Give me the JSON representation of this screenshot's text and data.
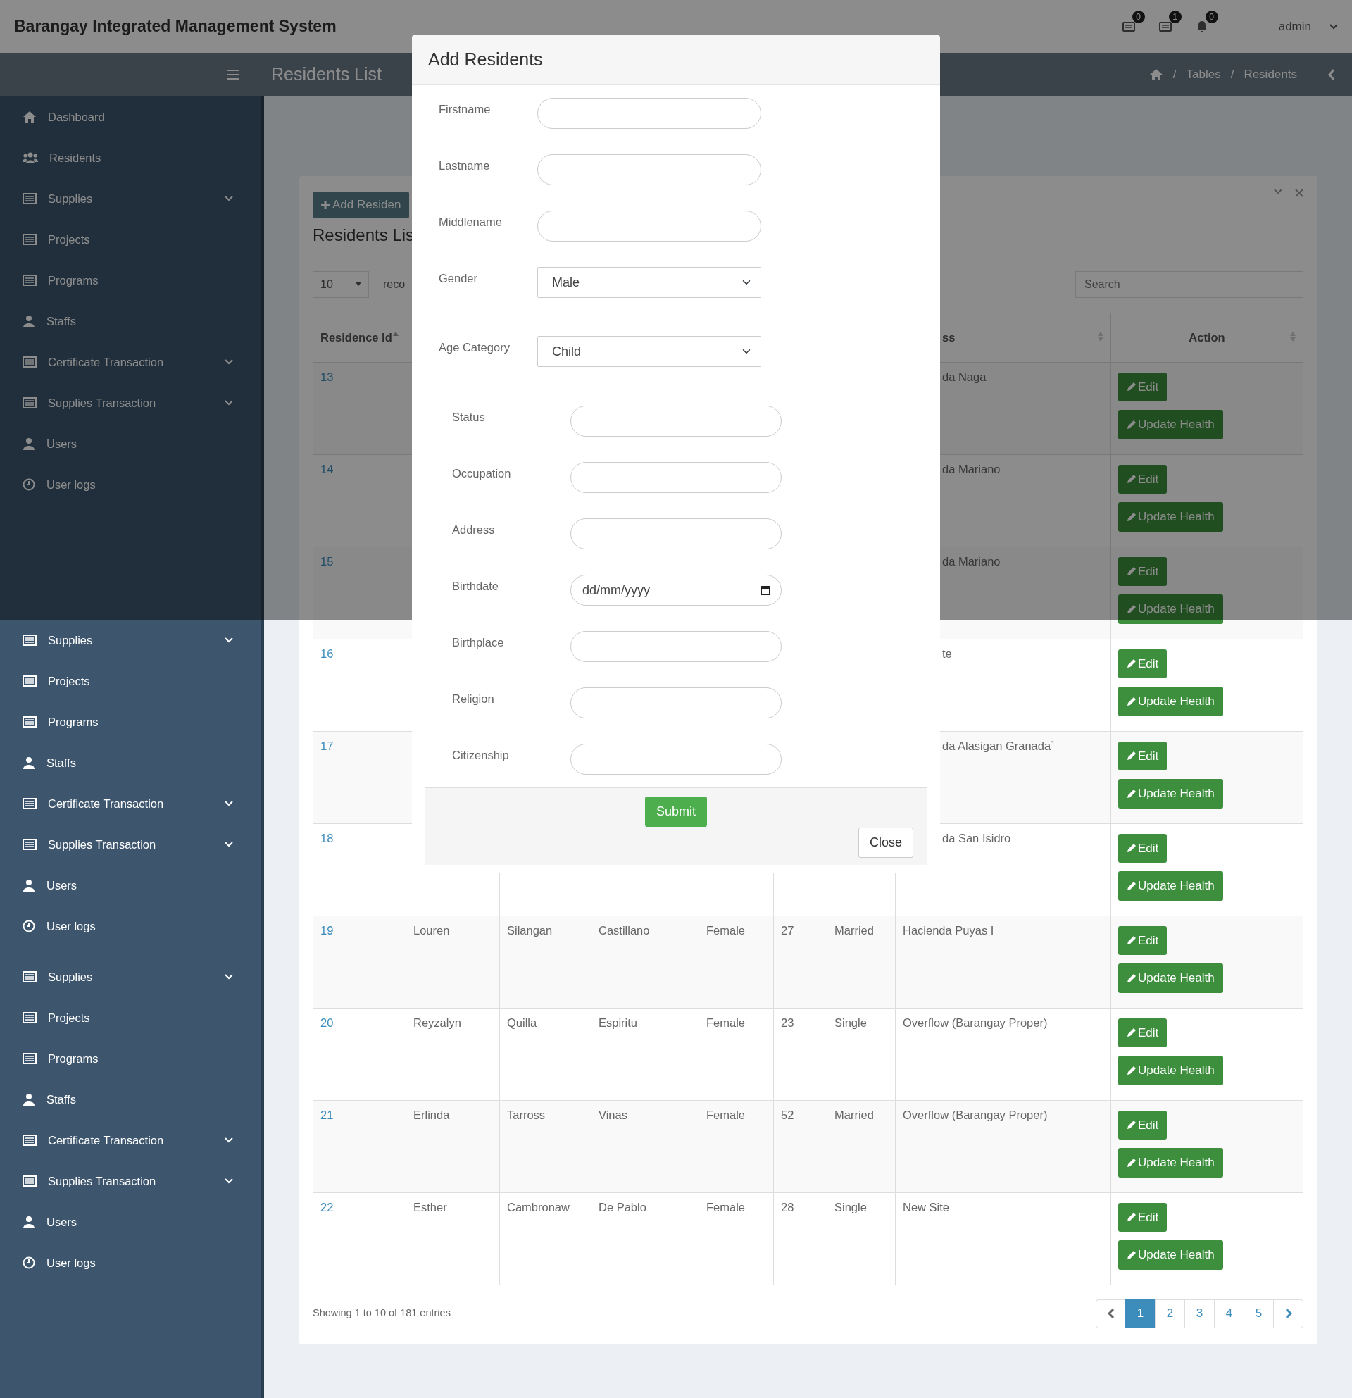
{
  "header": {
    "title": "Barangay Integrated Management System",
    "notifications": [
      {
        "count": "0"
      },
      {
        "count": "1"
      },
      {
        "count": "0"
      }
    ],
    "user": "admin"
  },
  "content_header": {
    "title": "Residents List",
    "breadcrumb": [
      {
        "separator": "/",
        "label": "Tables"
      },
      {
        "separator": "/",
        "label": "Residents"
      }
    ]
  },
  "sidebar": {
    "sections": [
      {
        "items": [
          {
            "label": "Dashboard",
            "expandable": false
          },
          {
            "label": "Residents",
            "expandable": false
          },
          {
            "label": "Supplies",
            "expandable": true
          },
          {
            "label": "Projects",
            "expandable": false
          },
          {
            "label": "Programs",
            "expandable": false
          },
          {
            "label": "Staffs",
            "expandable": false
          },
          {
            "label": "Certificate Transaction",
            "expandable": true
          },
          {
            "label": "Supplies Transaction",
            "expandable": true
          },
          {
            "label": "Users",
            "expandable": false
          },
          {
            "label": "User logs",
            "expandable": false
          }
        ]
      },
      {
        "items": [
          {
            "label": "Supplies",
            "expandable": true
          },
          {
            "label": "Projects",
            "expandable": false
          },
          {
            "label": "Programs",
            "expandable": false
          },
          {
            "label": "Staffs",
            "expandable": false
          },
          {
            "label": "Certificate Transaction",
            "expandable": true
          },
          {
            "label": "Supplies Transaction",
            "expandable": true
          },
          {
            "label": "Users",
            "expandable": false
          },
          {
            "label": "User logs",
            "expandable": false
          }
        ]
      },
      {
        "items": [
          {
            "label": "Supplies",
            "expandable": true
          },
          {
            "label": "Projects",
            "expandable": false
          },
          {
            "label": "Programs",
            "expandable": false
          },
          {
            "label": "Staffs",
            "expandable": false
          },
          {
            "label": "Certificate Transaction",
            "expandable": true
          },
          {
            "label": "Supplies Transaction",
            "expandable": true
          },
          {
            "label": "Users",
            "expandable": false
          },
          {
            "label": "User logs",
            "expandable": false
          }
        ]
      }
    ]
  },
  "panel": {
    "add_button": "Add Residen",
    "title": "Residents Lis",
    "length_value": "10",
    "length_label": "reco",
    "search_placeholder": "Search",
    "table": {
      "columns": [
        {
          "label": "Residence Id",
          "sorted": true
        },
        {},
        {},
        {},
        {},
        {},
        {},
        {
          "label": "ss",
          "sorted": false
        },
        {
          "label": "Action",
          "sorted": false
        }
      ],
      "rows": [
        {
          "id": "13",
          "address_fragment": "da Naga",
          "actions": [
            "Edit",
            "Update Health"
          ]
        },
        {
          "id": "14",
          "address_fragment": "da Mariano",
          "actions": [
            "Edit",
            "Update Health"
          ]
        },
        {
          "id": "15",
          "address_fragment": "da Mariano",
          "actions": [
            "Edit",
            "Update Health"
          ]
        },
        {
          "id": "16",
          "address_fragment": "te",
          "actions": [
            "Edit",
            "Update Health"
          ]
        },
        {
          "id": "17",
          "address_fragment": "da Alasigan Granada`",
          "actions": [
            "Edit",
            "Update Health"
          ]
        },
        {
          "id": "18",
          "address_fragment": "da San Isidro",
          "actions": [
            "Edit",
            "Update Health"
          ]
        },
        {
          "id": "19",
          "cells": [
            "Louren",
            "Silangan",
            "Castillano",
            "Female",
            "27",
            "Married",
            "Hacienda Puyas I"
          ],
          "actions": [
            "Edit",
            "Update Health"
          ]
        },
        {
          "id": "20",
          "cells": [
            "Reyzalyn",
            "Quilla",
            "Espiritu",
            "Female",
            "23",
            "Single",
            "Overflow (Barangay Proper)"
          ],
          "actions": [
            "Edit",
            "Update Health"
          ]
        },
        {
          "id": "21",
          "cells": [
            "Erlinda",
            "Tarross",
            "Vinas",
            "Female",
            "52",
            "Married",
            "Overflow (Barangay Proper)"
          ],
          "actions": [
            "Edit",
            "Update Health"
          ]
        },
        {
          "id": "22",
          "cells": [
            "Esther",
            "Cambronaw",
            "De Pablo",
            "Female",
            "28",
            "Single",
            "New Site"
          ],
          "actions": [
            "Edit",
            "Update Health"
          ]
        }
      ]
    },
    "info": "Showing 1 to 10 of 181 entries",
    "pages": [
      {
        "label": "1",
        "selected": true
      },
      {
        "label": "2",
        "selected": false
      },
      {
        "label": "3",
        "selected": false
      },
      {
        "label": "4",
        "selected": false
      },
      {
        "label": "5",
        "selected": false
      }
    ]
  },
  "modal": {
    "title": "Add Residents",
    "sections": [
      {
        "fields": [
          {
            "label": "Firstname",
            "kind": "text"
          },
          {
            "label": "Lastname",
            "kind": "text"
          },
          {
            "label": "Middlename",
            "kind": "text"
          },
          {
            "label": "Gender",
            "kind": "select",
            "value": "Male"
          }
        ]
      },
      {
        "fields": [
          {
            "label": "Age Category",
            "kind": "select",
            "value": "Child"
          }
        ]
      },
      {
        "fields": [
          {
            "label": "Status",
            "kind": "text"
          },
          {
            "label": "Occupation",
            "kind": "text"
          },
          {
            "label": "Address",
            "kind": "text"
          },
          {
            "label": "Birthdate",
            "kind": "date",
            "placeholder": "dd/mm/yyyy"
          },
          {
            "label": "Birthplace",
            "kind": "text"
          },
          {
            "label": "Religion",
            "kind": "text"
          },
          {
            "label": "Citizenship",
            "kind": "text"
          }
        ]
      }
    ],
    "submit": "Submit",
    "close": "Close"
  }
}
